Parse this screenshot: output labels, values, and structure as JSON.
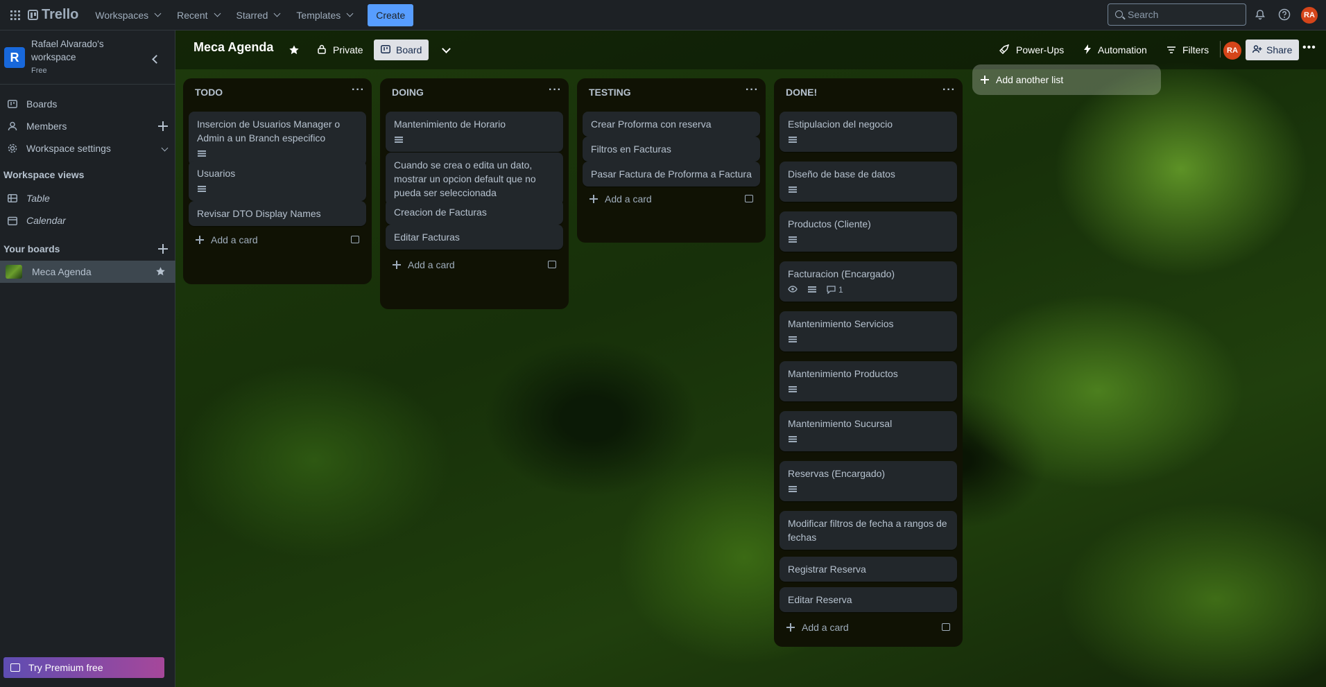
{
  "topbar": {
    "app_name": "Trello",
    "nav": [
      "Workspaces",
      "Recent",
      "Starred",
      "Templates"
    ],
    "create_label": "Create",
    "search_placeholder": "Search",
    "user_initials": "RA"
  },
  "sidebar": {
    "workspace_initial": "R",
    "workspace_name": "Rafael Alvarado's workspace",
    "workspace_plan": "Free",
    "items": [
      {
        "label": "Boards",
        "icon": "board-icon"
      },
      {
        "label": "Members",
        "icon": "person-icon"
      },
      {
        "label": "Workspace settings",
        "icon": "gear-icon"
      }
    ],
    "views_title": "Workspace views",
    "views": [
      {
        "label": "Table",
        "icon": "table-icon"
      },
      {
        "label": "Calendar",
        "icon": "calendar-icon"
      }
    ],
    "boards_title": "Your boards",
    "boards": [
      {
        "label": "Meca Agenda"
      }
    ],
    "premium_label": "Try Premium free"
  },
  "board": {
    "title": "Meca Agenda",
    "visibility": "Private",
    "view_label": "Board",
    "power_ups": "Power-Ups",
    "automation": "Automation",
    "filters": "Filters",
    "member_initials": "RA",
    "share_label": "Share",
    "add_list_label": "Add another list",
    "add_card_label": "Add a card",
    "lists": [
      {
        "title": "TODO",
        "cards": [
          {
            "title": "Insercion de Usuarios Manager o Admin a un Branch especifico",
            "has_description": true
          },
          {
            "title": "Usuarios",
            "has_description": true
          },
          {
            "title": "Revisar DTO Display Names",
            "has_description": false
          }
        ]
      },
      {
        "title": "DOING",
        "cards": [
          {
            "title": "Mantenimiento de Horario",
            "has_description": true
          },
          {
            "title": "Cuando se crea o edita un dato, mostrar un opcion default que no pueda ser seleccionada",
            "has_description": false
          },
          {
            "title": "Creacion de Facturas",
            "has_description": false
          },
          {
            "title": "Editar Facturas",
            "has_description": false
          }
        ]
      },
      {
        "title": "TESTING",
        "cards": [
          {
            "title": "Crear Proforma con reserva",
            "has_description": false
          },
          {
            "title": "Filtros en Facturas",
            "has_description": false
          },
          {
            "title": "Pasar Factura de Proforma a Factura",
            "has_description": false
          }
        ]
      },
      {
        "title": "DONE!",
        "cards": [
          {
            "title": "Estipulacion del negocio",
            "has_description": true
          },
          {
            "title": "Diseño de base de datos",
            "has_description": true
          },
          {
            "title": "Productos (Cliente)",
            "has_description": true
          },
          {
            "title": "Facturacion (Encargado)",
            "has_description": true,
            "watching": true,
            "comments": "1"
          },
          {
            "title": "Mantenimiento Servicios",
            "has_description": true
          },
          {
            "title": "Mantenimiento Productos",
            "has_description": true
          },
          {
            "title": "Mantenimiento Sucursal",
            "has_description": true
          },
          {
            "title": "Reservas (Encargado)",
            "has_description": true
          },
          {
            "title": "Modificar filtros de fecha a rangos de fechas",
            "has_description": false
          },
          {
            "title": "Registrar Reserva",
            "has_description": false
          },
          {
            "title": "Editar Reserva",
            "has_description": false
          }
        ]
      }
    ]
  },
  "colors": {
    "accent": "#579dff",
    "avatar": "#d5451a",
    "list_bg": "#101204",
    "card_bg": "#22272b"
  }
}
